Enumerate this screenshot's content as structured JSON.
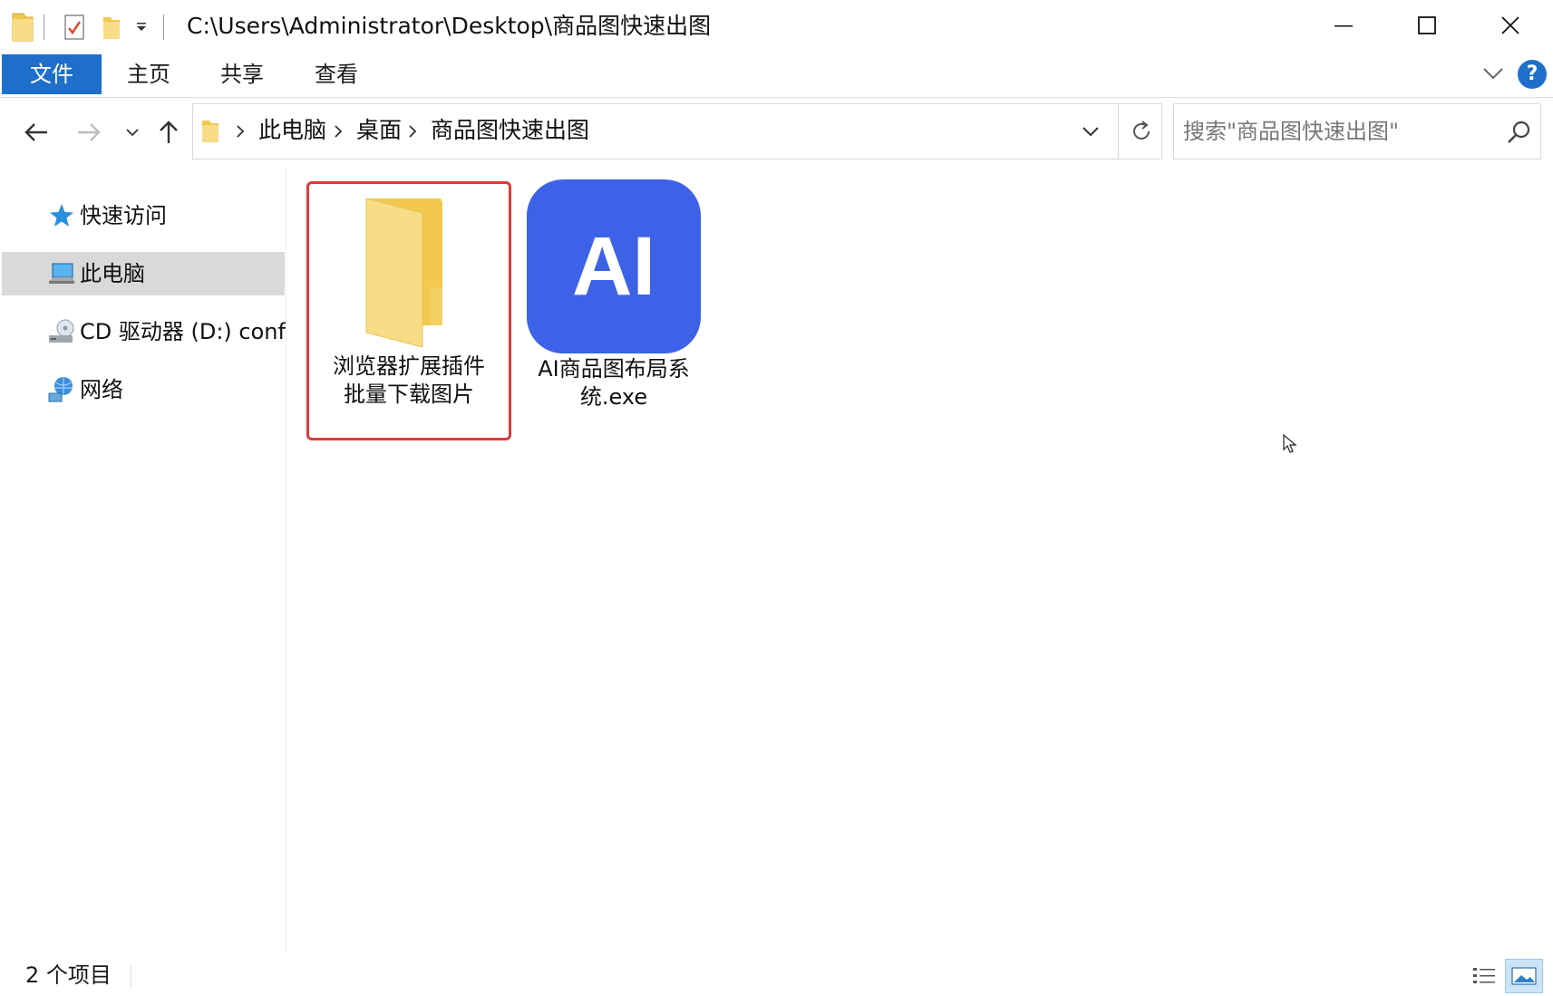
{
  "window": {
    "title": "C:\\Users\\Administrator\\Desktop\\商品图快速出图"
  },
  "ribbon": {
    "tabs": [
      {
        "label": "文件"
      },
      {
        "label": "主页"
      },
      {
        "label": "共享"
      },
      {
        "label": "查看"
      }
    ],
    "help_label": "?"
  },
  "address": {
    "breadcrumbs": [
      "此电脑",
      "桌面",
      "商品图快速出图"
    ]
  },
  "search": {
    "placeholder": "搜索\"商品图快速出图\""
  },
  "sidebar": {
    "items": [
      {
        "label": "快速访问",
        "icon": "star-icon"
      },
      {
        "label": "此电脑",
        "icon": "computer-icon"
      },
      {
        "label": "CD 驱动器 (D:) config",
        "icon": "cd-drive-icon"
      },
      {
        "label": "网络",
        "icon": "network-icon"
      }
    ]
  },
  "files": [
    {
      "name_line1": "浏览器扩展插件",
      "name_line2": "批量下载图片",
      "type": "folder",
      "icon": "folder-icon"
    },
    {
      "name_line1": "AI商品图布局系",
      "name_line2": "统.exe",
      "type": "exe",
      "icon_text": "AI"
    }
  ],
  "status": {
    "item_count": "2 个项目"
  },
  "colors": {
    "accent": "#1e6fcb",
    "selection_border": "#e0393a",
    "ai_tile": "#3d62e7",
    "folder": "#f5d577"
  }
}
